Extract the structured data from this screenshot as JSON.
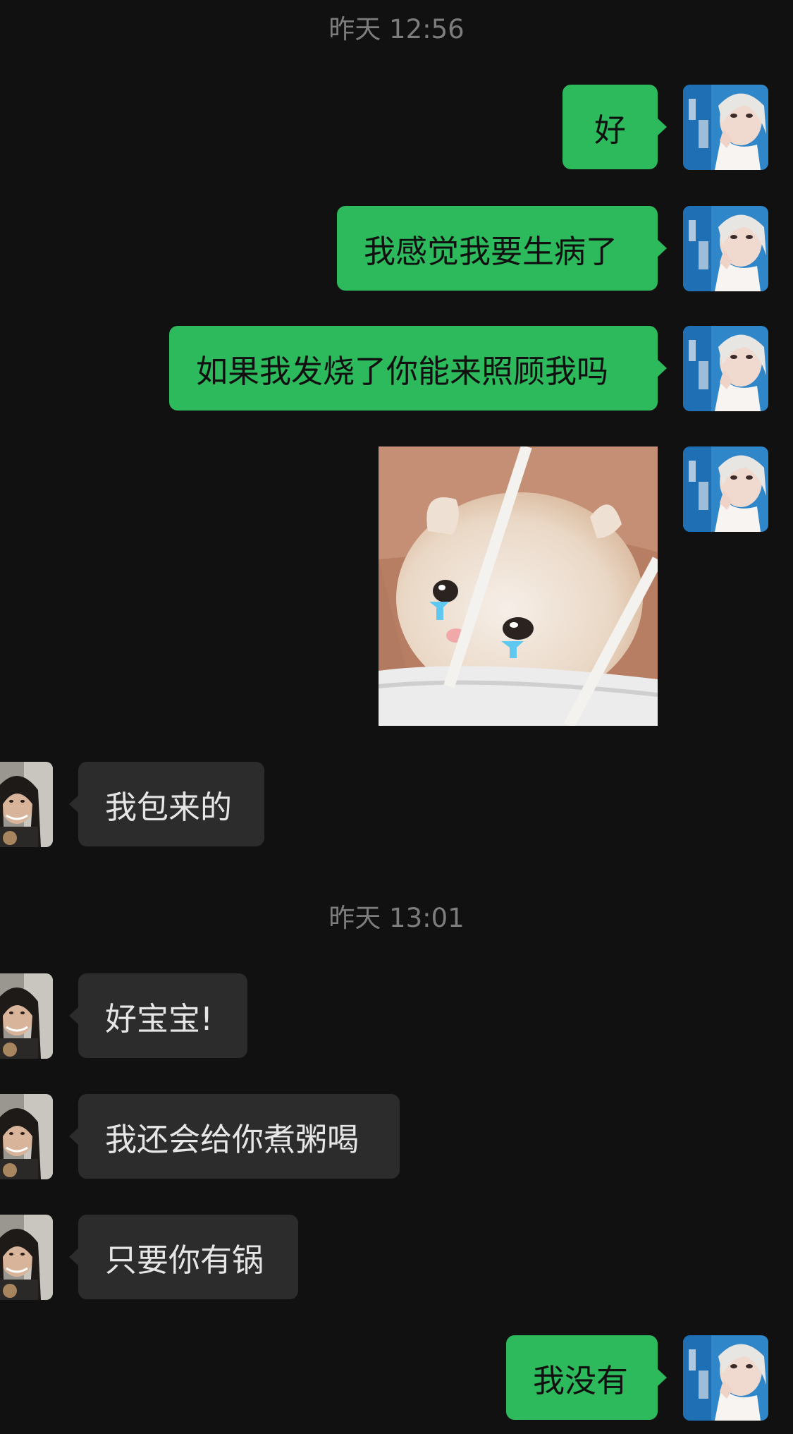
{
  "chat": {
    "timestamps": [
      "昨天 12:56",
      "昨天 13:01"
    ],
    "messages": [
      {
        "side": "out",
        "type": "text",
        "text": "好"
      },
      {
        "side": "out",
        "type": "text",
        "text": "我感觉我要生病了"
      },
      {
        "side": "out",
        "type": "text",
        "text": "如果我发烧了你能来照顾我吗"
      },
      {
        "side": "out",
        "type": "image",
        "description_icon": "crying-kitten-sticker"
      },
      {
        "side": "in",
        "type": "text",
        "text": "我包来的"
      },
      {
        "side": "in",
        "type": "text",
        "text": "好宝宝!"
      },
      {
        "side": "in",
        "type": "text",
        "text": "我还会给你煮粥喝"
      },
      {
        "side": "in",
        "type": "text",
        "text": "只要你有锅"
      },
      {
        "side": "out",
        "type": "text",
        "text": "我没有"
      }
    ]
  },
  "colors": {
    "background": "#111111",
    "outgoing_bubble": "#2dba5c",
    "incoming_bubble": "#2c2c2c",
    "timestamp_text": "#7d7d7d"
  }
}
